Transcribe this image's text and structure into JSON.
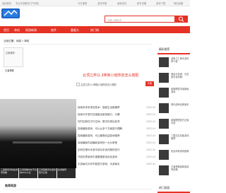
{
  "topbar": {
    "links": [
      "返回首页",
      "专业手游服务门户网站",
      "今日推荐",
      "游戏专题",
      "最新资讯",
      "新手攻略",
      "游戏下载",
      "网站地图"
    ]
  },
  "logo": {
    "text": "网"
  },
  "search": {
    "placeholder": "请输入搜索词"
  },
  "nav": {
    "items": [
      "首页",
      "单机",
      "网游新闻",
      "软件",
      "重要大",
      "热门网"
    ]
  },
  "breadcrumb": "当前位置：网游 > 单机",
  "ad": {
    "caption": "正版官网",
    "label": "王者荣耀"
  },
  "headline": "云顶之弈11.3神族小炮阵容怎么搭配",
  "image_caption": "云顶之弈11.3神族小炮阵容怎么搭配",
  "image_tag": "头条",
  "news": [
    {
      "title": "探索未来未来的技术：智能生活新篇章",
      "date": "2022-04"
    },
    {
      "title": "探索与开发时空维度全新突破口，引爆",
      "date": "2022-04"
    },
    {
      "title": "在时空和在平行空间，数字化带出探寻",
      "date": "2022-04"
    },
    {
      "title": "探索最新游戏，可以从多个方面进行理解",
      "date": "2022-04"
    },
    {
      "title": "探索最新游戏，可让最受欢迎游戏推荐",
      "date": "2022-04"
    },
    {
      "title": "探索最新内容最新游戏的一大片奇怪",
      "date": "2022-04"
    },
    {
      "title": "如何在神州手游中成功手游开服的技巧",
      "date": "2022-04"
    },
    {
      "title": "开放世界游戏中重要更新及优化游戏",
      "date": "2022-04"
    },
    {
      "title": "手游每天为何不能进行游戏，手游每天",
      "date": "2022-04"
    }
  ],
  "thumbs": [
    "三国群英传新版游戏攻略",
    "王者荣耀中秋节活动2021大全",
    "王者荣耀手机游戏官方正版",
    "新游推荐"
  ],
  "section_title": "推荐网游",
  "right_panel": {
    "heading": "精彩推荐",
    "items": [
      "战争之仁神手游传奇下载",
      "神话与传承，在这里手游攻略",
      "英雄联盟中最新版游戏",
      "现代战争全新版本",
      "英雄联盟官方正版手游",
      "三国志名将版游戏推荐",
      "热血传奇游戏推荐",
      "王者荣耀最新版游戏攻略"
    ],
    "bottom_heading": "热门网游"
  }
}
